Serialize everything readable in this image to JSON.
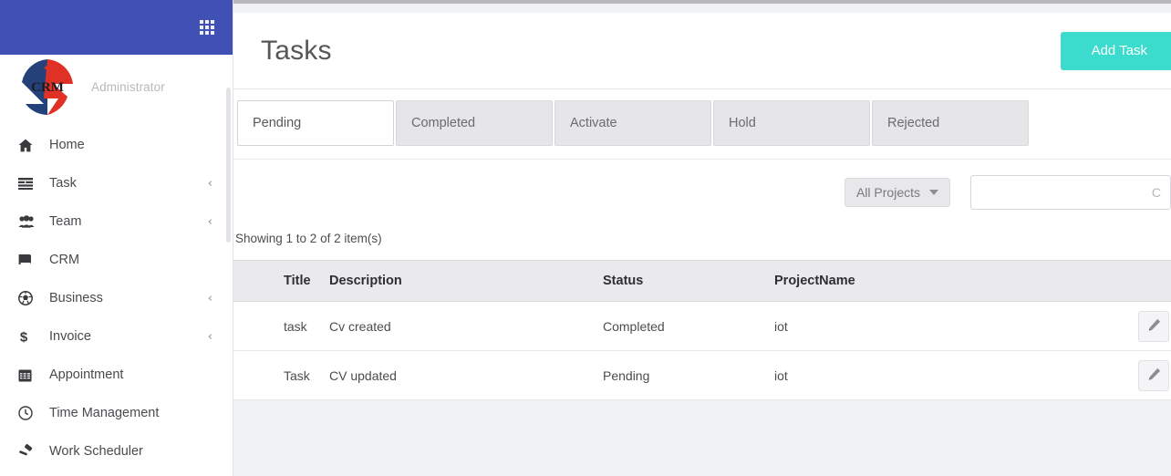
{
  "sidebar": {
    "grid_icon": "apps-grid-icon",
    "brand": {
      "logo_text": "CRM",
      "role_label": "Administrator"
    },
    "items": [
      {
        "label": "Home",
        "icon": "home-icon",
        "caret": ""
      },
      {
        "label": "Task",
        "icon": "list-icon",
        "caret": "‹"
      },
      {
        "label": "Team",
        "icon": "users-icon",
        "caret": "‹"
      },
      {
        "label": "CRM",
        "icon": "book-icon",
        "caret": ""
      },
      {
        "label": "Business",
        "icon": "soccer-ball-icon",
        "caret": "‹"
      },
      {
        "label": "Invoice",
        "icon": "dollar-icon",
        "caret": "‹"
      },
      {
        "label": "Appointment",
        "icon": "calendar-icon",
        "caret": ""
      },
      {
        "label": "Time Management",
        "icon": "clock-icon",
        "caret": ""
      },
      {
        "label": "Work Scheduler",
        "icon": "gavel-icon",
        "caret": ""
      }
    ]
  },
  "header": {
    "title": "Tasks",
    "add_button": "Add Task"
  },
  "tabs": [
    {
      "label": "Pending",
      "active": true
    },
    {
      "label": "Completed",
      "active": false
    },
    {
      "label": "Activate",
      "active": false
    },
    {
      "label": "Hold",
      "active": false
    },
    {
      "label": "Rejected",
      "active": false
    }
  ],
  "toolbar": {
    "project_filter": "All Projects",
    "search_placeholder": "C"
  },
  "table": {
    "summary": "Showing 1 to 2 of 2 item(s)",
    "columns": [
      "Title",
      "Description",
      "Status",
      "ProjectName"
    ],
    "rows": [
      {
        "title": "task",
        "description": "Cv created",
        "status": "Completed",
        "project": "iot",
        "action_icon": "edit-pencil-icon"
      },
      {
        "title": "Task",
        "description": "CV updated",
        "status": "Pending",
        "project": "iot",
        "action_icon": "edit-pencil-icon"
      }
    ]
  },
  "colors": {
    "sidebar_header_blue": "#4050b5",
    "accent_teal": "#3bdccd",
    "table_header_gray": "#eaeaec",
    "logo_navy": "#25417a",
    "logo_red": "#e03127"
  }
}
